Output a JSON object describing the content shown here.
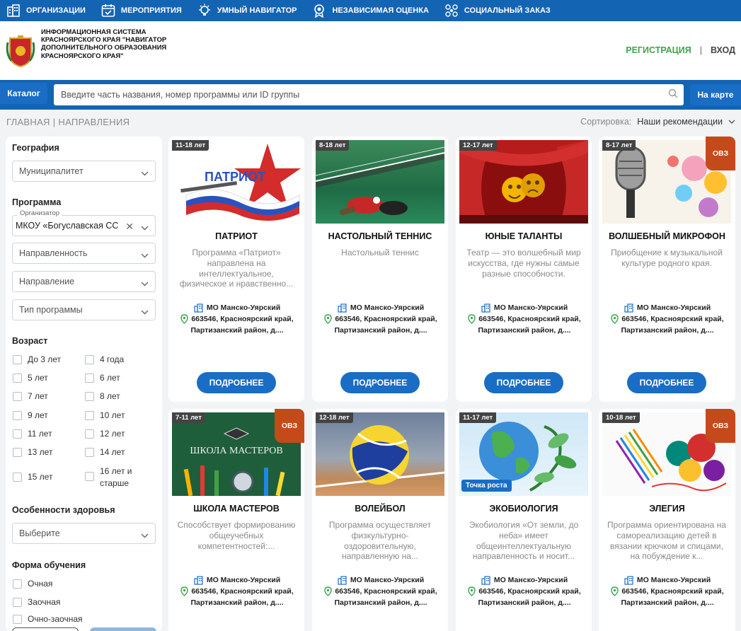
{
  "topnav": {
    "items": [
      {
        "label": "ОРГАНИЗАЦИИ",
        "icon": "building-icon"
      },
      {
        "label": "МЕРОПРИЯТИЯ",
        "icon": "calendar-icon"
      },
      {
        "label": "УМНЫЙ НАВИГАТОР",
        "icon": "bulb-icon"
      },
      {
        "label": "НЕЗАВИСИМАЯ ОЦЕНКА",
        "icon": "award-icon"
      },
      {
        "label": "СОЦИАЛЬНЫЙ ЗАКАЗ",
        "icon": "network-icon"
      }
    ]
  },
  "header": {
    "title": "ИНФОРМАЦИОННАЯ СИСТЕМА КРАСНОЯРСКОГО КРАЯ \"НАВИГАТОР ДОПОЛНИТЕЛЬНОГО ОБРАЗОВАНИЯ КРАСНОЯРСКОГО КРАЯ\"",
    "register": "РЕГИСТРАЦИЯ",
    "separator": "|",
    "login": "ВХОД"
  },
  "search": {
    "catalog": "Каталог",
    "placeholder": "Введите часть названия, номер программы или ID группы",
    "map": "На карте"
  },
  "breadcrumb": {
    "home": "ГЛАВНАЯ",
    "sep": "|",
    "current": "НАПРАВЛЕНИЯ"
  },
  "sort": {
    "label": "Сортировка:",
    "value": "Наши рекомендации"
  },
  "filters": {
    "geography": "География",
    "municipality": "Муниципалитет",
    "program": "Программа",
    "organizer_label": "Организатор",
    "organizer_value": "МКОУ «Богуславская СС",
    "focus": "Направленность",
    "direction": "Направление",
    "program_type": "Тип программы",
    "age": "Возраст",
    "ages": [
      "До 3 лет",
      "4 года",
      "5 лет",
      "6 лет",
      "7 лет",
      "8 лет",
      "9 лет",
      "10 лет",
      "11 лет",
      "12 лет",
      "13 лет",
      "14 лет",
      "15 лет",
      "16 лет и старше"
    ],
    "health": "Особенности здоровья",
    "health_select": "Выберите",
    "form": "Форма обучения",
    "forms": [
      "Очная",
      "Заочная",
      "Очно-заочная"
    ]
  },
  "cards": [
    {
      "age": "11-18 лет",
      "title": "ПАТРИОТ",
      "desc": "Программа «Патриот» направлена на интеллектуальное, физическое и нравственно...",
      "ovz": "",
      "badge": ""
    },
    {
      "age": "8-18 лет",
      "title": "НАСТОЛЬНЫЙ ТЕННИС",
      "desc": "Настольный теннис",
      "ovz": "",
      "badge": ""
    },
    {
      "age": "12-17 лет",
      "title": "ЮНЫЕ ТАЛАНТЫ",
      "desc": "Театр — это волшебный мир искусства, где нужны самые разные способности.",
      "ovz": "",
      "badge": ""
    },
    {
      "age": "8-17 лет",
      "title": "ВОЛШЕБНЫЙ МИКРОФОН",
      "desc": "Приобщение к музыкальной культуре родного края.",
      "ovz": "ОВЗ",
      "badge": ""
    },
    {
      "age": "7-11 лет",
      "title": "ШКОЛА МАСТЕРОВ",
      "desc": "Способствует формированию общеучебных компетентностей:...",
      "ovz": "ОВЗ",
      "badge": "",
      "img_text": "ШКОЛА МАСТЕРОВ"
    },
    {
      "age": "12-18 лет",
      "title": "ВОЛЕЙБОЛ",
      "desc": "Программа осуществляет физкультурно-оздоровительную, направленную на...",
      "ovz": "",
      "badge": ""
    },
    {
      "age": "11-17 лет",
      "title": "ЭКОБИОЛОГИЯ",
      "desc": "Экобиология «От земли, до неба» имеет общеинтеллектуальную направленность и носит...",
      "ovz": "",
      "badge": "Точка роста"
    },
    {
      "age": "10-18 лет",
      "title": "ЭЛЕГИЯ",
      "desc": "Программа ориентирована на самореализацию детей в вязании крючком и спицами, на побуждение к...",
      "ovz": "ОВЗ",
      "badge": ""
    }
  ],
  "card_common": {
    "org": "МО Манско-Уярский",
    "addr1": "663546, Красноярский край,",
    "addr2": "Партизанский район, д....",
    "more": "ПОДРОБНЕЕ"
  },
  "patriot_img_text": "ПАТРИОТ",
  "colors": {
    "brand": "#1464b4",
    "button": "#1a6dc4",
    "ovz": "#c54a1a",
    "register": "#3fa34d"
  }
}
